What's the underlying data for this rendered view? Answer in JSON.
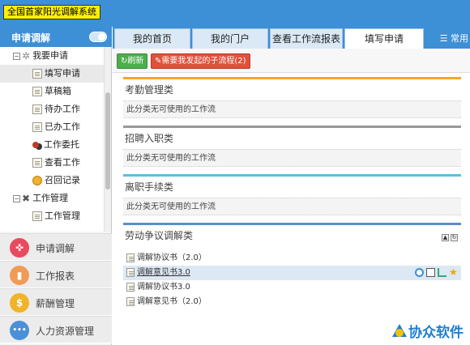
{
  "app": {
    "title": "全国首家阳光调解系统"
  },
  "sidebar": {
    "header": "申请调解",
    "tree": [
      {
        "label": "我要申请",
        "type": "folder"
      },
      {
        "label": "填写申请",
        "type": "page",
        "selected": true
      },
      {
        "label": "草稿箱",
        "type": "page"
      },
      {
        "label": "待办工作",
        "type": "page"
      },
      {
        "label": "已办工作",
        "type": "page"
      },
      {
        "label": "工作委托",
        "type": "people"
      },
      {
        "label": "查看工作",
        "type": "page"
      },
      {
        "label": "召回记录",
        "type": "undo"
      },
      {
        "label": "工作管理",
        "type": "folder"
      },
      {
        "label": "工作管理",
        "type": "page"
      }
    ],
    "modules": [
      {
        "label": "申请调解",
        "icon": "handshake-icon",
        "color": "#e84a5f",
        "glyph": "✜"
      },
      {
        "label": "工作报表",
        "icon": "chart-icon",
        "color": "#f29b56",
        "glyph": "▮"
      },
      {
        "label": "薪酬管理",
        "icon": "money-bag-icon",
        "color": "#f0b429",
        "glyph": "$"
      },
      {
        "label": "人力资源管理",
        "icon": "more-dots-icon",
        "color": "#4a90d9",
        "glyph": "•••"
      }
    ]
  },
  "tabs": [
    {
      "label": "我的首页"
    },
    {
      "label": "我的门户"
    },
    {
      "label": "查看工作流报表"
    },
    {
      "label": "填写申请",
      "active": true
    }
  ],
  "tab_more": "常用",
  "toolbar": {
    "refresh": "刷新",
    "subflow": "需要我发起的子流程(2)"
  },
  "groups": [
    {
      "title": "考勤管理类",
      "empty": "此分类无可使用的工作流",
      "color": "#f5a623"
    },
    {
      "title": "招聘入职类",
      "empty": "此分类无可使用的工作流",
      "color": "#999999"
    },
    {
      "title": "离职手续类",
      "empty": "此分类无可使用的工作流",
      "color": "#5bc0de"
    },
    {
      "title": "劳动争议调解类",
      "color": "#5b8fc7"
    }
  ],
  "flows": [
    {
      "label": "调解协议书（2.0）"
    },
    {
      "label": "调解意见书3.0",
      "highlighted": true
    },
    {
      "label": "调解协议书3.0"
    },
    {
      "label": "调解意见书（2.0）"
    }
  ],
  "logo": {
    "text": "协众软件"
  }
}
